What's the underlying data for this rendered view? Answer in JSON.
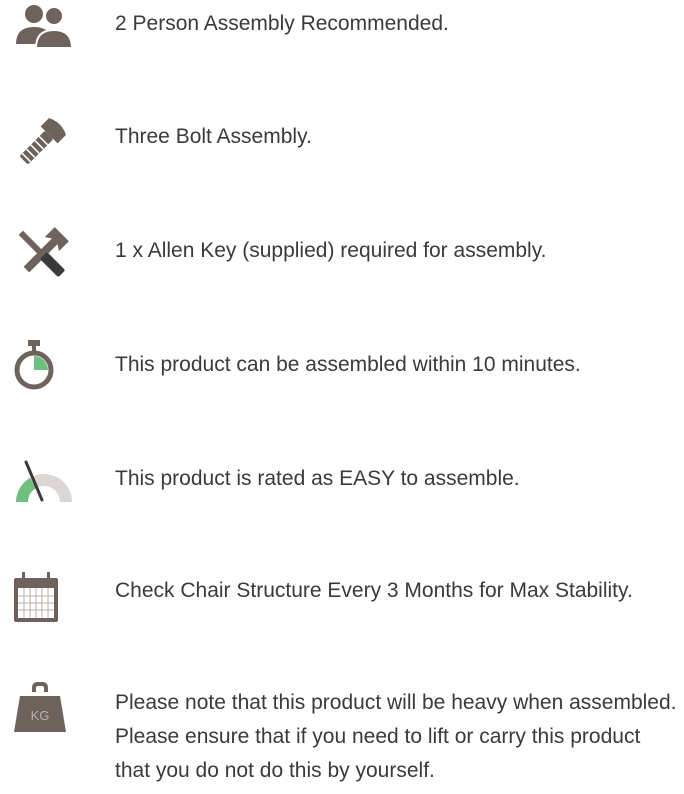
{
  "colors": {
    "icon_gray": "#6e625d",
    "accent_green": "#6fbf7f",
    "gauge_light": "#dcd7d4",
    "text": "#3a3a3a"
  },
  "items": [
    {
      "icon": "two-persons-icon",
      "text": "2 Person Assembly Recommended."
    },
    {
      "icon": "bolt-icon",
      "text": "Three Bolt Assembly."
    },
    {
      "icon": "tools-icon",
      "text": "1 x Allen Key (supplied) required for assembly."
    },
    {
      "icon": "stopwatch-icon",
      "text": "This product can be assembled within 10 minutes."
    },
    {
      "icon": "gauge-icon",
      "text": "This product is rated as EASY to assemble."
    },
    {
      "icon": "calendar-icon",
      "text": "Check Chair Structure Every 3 Months for Max Stability."
    },
    {
      "icon": "weight-icon",
      "label": "KG",
      "text": "Please note that this product will be heavy when assembled. Please ensure that if you need to lift or carry this product that you do not do this by yourself."
    }
  ]
}
